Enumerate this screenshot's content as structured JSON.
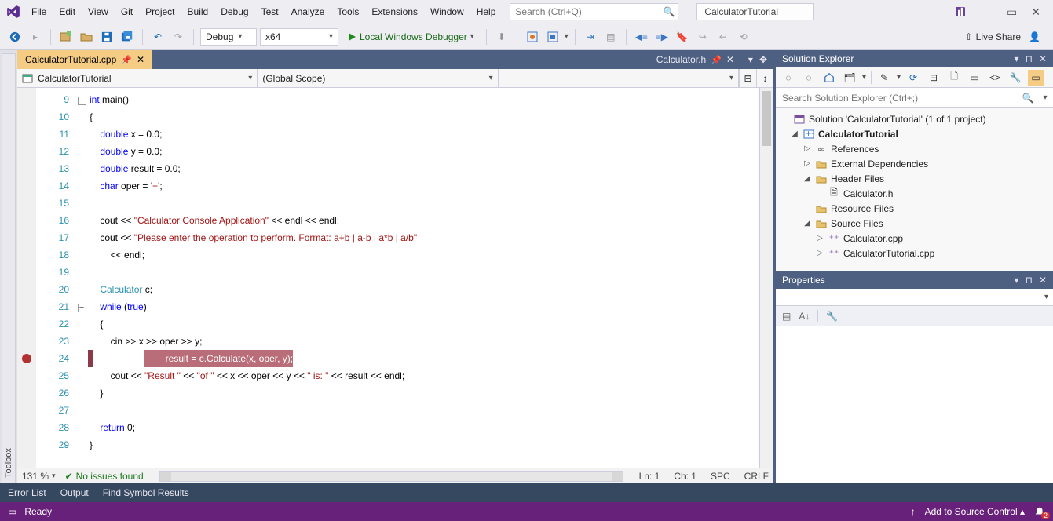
{
  "menu": {
    "items": [
      "File",
      "Edit",
      "View",
      "Git",
      "Project",
      "Build",
      "Debug",
      "Test",
      "Analyze",
      "Tools",
      "Extensions",
      "Window",
      "Help"
    ],
    "search_placeholder": "Search (Ctrl+Q)",
    "solution_name": "CalculatorTutorial"
  },
  "toolbar": {
    "config": "Debug",
    "platform": "x64",
    "debugger_label": "Local Windows Debugger",
    "live_share": "Live Share"
  },
  "toolbox_label": "Toolbox",
  "tabs": {
    "active": "CalculatorTutorial.cpp",
    "background": "Calculator.h"
  },
  "navcombo": {
    "project": "CalculatorTutorial",
    "scope": "(Global Scope)",
    "member": ""
  },
  "editor": {
    "first_line": 9,
    "breakpoint_line": 24,
    "highlight_line": 24,
    "lines": [
      {
        "n": 9,
        "fold": "-",
        "t": [
          [
            "kw",
            "int"
          ],
          [
            "op",
            " "
          ],
          [
            "op",
            "main()"
          ]
        ]
      },
      {
        "n": 10,
        "t": [
          [
            "op",
            "{"
          ]
        ]
      },
      {
        "n": 11,
        "t": [
          [
            "op",
            "    "
          ],
          [
            "kw",
            "double"
          ],
          [
            "op",
            " x = 0.0;"
          ]
        ]
      },
      {
        "n": 12,
        "t": [
          [
            "op",
            "    "
          ],
          [
            "kw",
            "double"
          ],
          [
            "op",
            " y = 0.0;"
          ]
        ]
      },
      {
        "n": 13,
        "t": [
          [
            "op",
            "    "
          ],
          [
            "kw",
            "double"
          ],
          [
            "op",
            " result = 0.0;"
          ]
        ]
      },
      {
        "n": 14,
        "t": [
          [
            "op",
            "    "
          ],
          [
            "kw",
            "char"
          ],
          [
            "op",
            " oper = "
          ],
          [
            "st",
            "'+'"
          ],
          [
            "op",
            ";"
          ]
        ]
      },
      {
        "n": 15,
        "t": [
          [
            "op",
            ""
          ]
        ]
      },
      {
        "n": 16,
        "t": [
          [
            "op",
            "    cout << "
          ],
          [
            "st",
            "\"Calculator Console Application\""
          ],
          [
            "op",
            " << endl << endl;"
          ]
        ]
      },
      {
        "n": 17,
        "t": [
          [
            "op",
            "    cout << "
          ],
          [
            "st",
            "\"Please enter the operation to perform. Format: a+b | a-b | a*b | a/b\""
          ]
        ]
      },
      {
        "n": 18,
        "t": [
          [
            "op",
            "        << endl;"
          ]
        ]
      },
      {
        "n": 19,
        "t": [
          [
            "op",
            ""
          ]
        ]
      },
      {
        "n": 20,
        "t": [
          [
            "op",
            "    "
          ],
          [
            "ty",
            "Calculator"
          ],
          [
            "op",
            " c;"
          ]
        ]
      },
      {
        "n": 21,
        "fold": "-",
        "t": [
          [
            "op",
            "    "
          ],
          [
            "kw",
            "while"
          ],
          [
            "op",
            " ("
          ],
          [
            "kw",
            "true"
          ],
          [
            "op",
            ")"
          ]
        ]
      },
      {
        "n": 22,
        "t": [
          [
            "op",
            "    {"
          ]
        ]
      },
      {
        "n": 23,
        "t": [
          [
            "op",
            "        cin >> x >> oper >> y;"
          ]
        ]
      },
      {
        "n": 24,
        "t": [
          [
            "op",
            "        result = c.Calculate(x, oper, y);"
          ]
        ]
      },
      {
        "n": 25,
        "t": [
          [
            "op",
            "        cout << "
          ],
          [
            "st",
            "\"Result \""
          ],
          [
            "op",
            " << "
          ],
          [
            "st",
            "\"of \""
          ],
          [
            "op",
            " << x << oper << y << "
          ],
          [
            "st",
            "\" is: \""
          ],
          [
            "op",
            " << result << endl;"
          ]
        ]
      },
      {
        "n": 26,
        "t": [
          [
            "op",
            "    }"
          ]
        ]
      },
      {
        "n": 27,
        "t": [
          [
            "op",
            ""
          ]
        ]
      },
      {
        "n": 28,
        "t": [
          [
            "op",
            "    "
          ],
          [
            "kw",
            "return"
          ],
          [
            "op",
            " 0;"
          ]
        ]
      },
      {
        "n": 29,
        "t": [
          [
            "op",
            "}"
          ]
        ]
      }
    ]
  },
  "editor_status": {
    "zoom": "131 %",
    "issues": "No issues found",
    "ln": "Ln: 1",
    "ch": "Ch: 1",
    "spc": "SPC",
    "crlf": "CRLF"
  },
  "solution_explorer": {
    "title": "Solution Explorer",
    "search_placeholder": "Search Solution Explorer (Ctrl+;)",
    "root": "Solution 'CalculatorTutorial' (1 of 1 project)",
    "project": "CalculatorTutorial",
    "nodes": {
      "references": "References",
      "external": "External Dependencies",
      "headers": "Header Files",
      "calculator_h": "Calculator.h",
      "resources": "Resource Files",
      "sources": "Source Files",
      "calculator_cpp": "Calculator.cpp",
      "tutorial_cpp": "CalculatorTutorial.cpp"
    }
  },
  "properties": {
    "title": "Properties"
  },
  "bottom_tabs": {
    "a": "Error List",
    "b": "Output",
    "c": "Find Symbol Results"
  },
  "status": {
    "ready": "Ready",
    "source_control": "Add to Source Control",
    "notifications": "2"
  }
}
